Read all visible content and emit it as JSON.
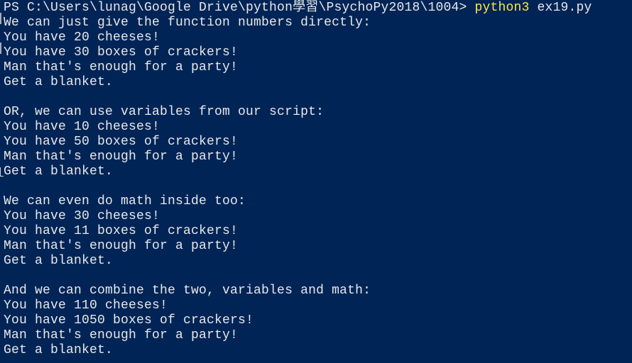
{
  "prompt": {
    "path": "PS C:\\Users\\lunag\\Google Drive\\python學習\\PsychoPy2018\\1004> ",
    "command": "python3",
    "argument": " ex19.py"
  },
  "output_lines": [
    "We can just give the function numbers directly:",
    "You have 20 cheeses!",
    "You have 30 boxes of crackers!",
    "Man that's enough for a party!",
    "Get a blanket.",
    "",
    "OR, we can use variables from our script:",
    "You have 10 cheeses!",
    "You have 50 boxes of crackers!",
    "Man that's enough for a party!",
    "Get a blanket.",
    "",
    "We can even do math inside too:",
    "You have 30 cheeses!",
    "You have 11 boxes of crackers!",
    "Man that's enough for a party!",
    "Get a blanket.",
    "",
    "And we can combine the two, variables and math:",
    "You have 110 cheeses!",
    "You have 1050 boxes of crackers!",
    "Man that's enough for a party!",
    "Get a blanket."
  ],
  "colors": {
    "background": "#012456",
    "text": "#e8e8e8",
    "command": "#f5e84a"
  }
}
